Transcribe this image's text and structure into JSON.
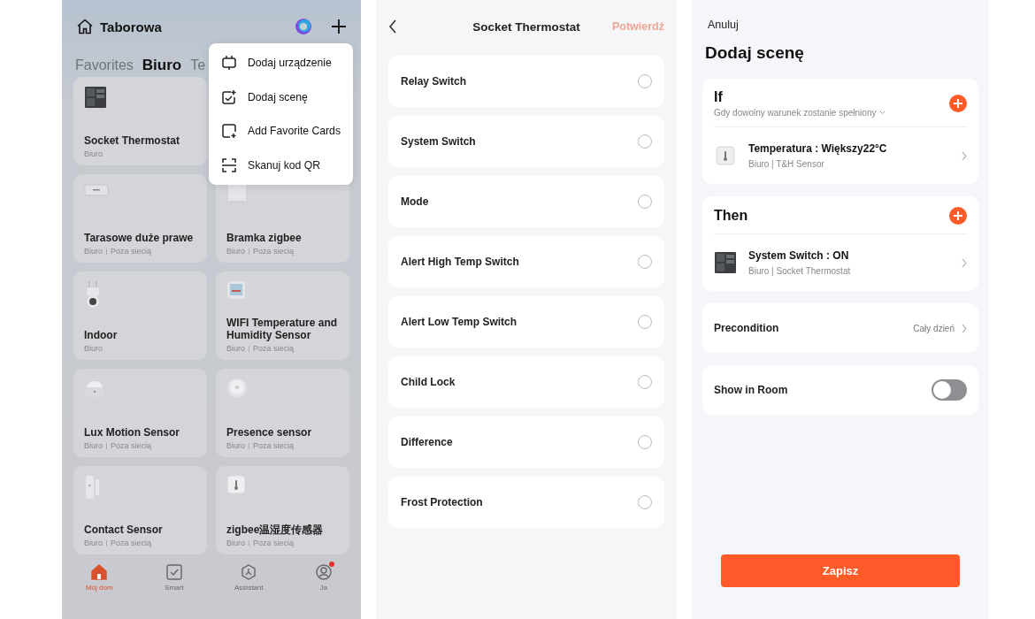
{
  "home": {
    "title": "Taborowa",
    "tabs": [
      {
        "label": "Favorites",
        "selected": false
      },
      {
        "label": "Biuro",
        "selected": true
      },
      {
        "label": "Te",
        "selected": false
      }
    ],
    "menu": [
      {
        "kind": "device",
        "label": "Dodaj urządzenie"
      },
      {
        "kind": "scene",
        "label": "Dodaj scenę"
      },
      {
        "kind": "card",
        "label": "Add Favorite Cards"
      },
      {
        "kind": "scan",
        "label": "Skanuj kod QR"
      }
    ],
    "device_rows": [
      [
        {
          "kind": "socket",
          "name": "Socket Thermostat",
          "room": "Biuro"
        }
      ],
      [
        {
          "kind": "panel",
          "name": "Tarasowe duże prawe",
          "room": "Biuro",
          "status": "Poza siecią"
        },
        {
          "kind": "hub",
          "name": "Bramka zigbee",
          "room": "Biuro",
          "status": "Poza siecią"
        }
      ],
      [
        {
          "kind": "camera",
          "name": "Indoor",
          "room": "Biuro"
        },
        {
          "kind": "display",
          "name": "WIFI Temperature and Humidity Sensor",
          "room": "Biuro",
          "status": "Poza siecią"
        }
      ],
      [
        {
          "kind": "motion",
          "name": "Lux Motion Sensor",
          "room": "Biuro",
          "status": "Poza siecią"
        },
        {
          "kind": "presence",
          "name": "Presence sensor",
          "room": "Biuro",
          "status": "Poza siecią"
        }
      ],
      [
        {
          "kind": "contact",
          "name": "Contact Sensor",
          "room": "Biuro",
          "status": "Poza siecią"
        },
        {
          "kind": "thermo",
          "name": "zigbee温湿度传感器",
          "room": "Biuro",
          "status": "Poza siecią"
        }
      ]
    ],
    "nav": [
      {
        "kind": "home",
        "label": "Mój dom",
        "selected": true,
        "badge": false
      },
      {
        "kind": "smart",
        "label": "Smart",
        "selected": false,
        "badge": false
      },
      {
        "kind": "assistant",
        "label": "Assistant",
        "selected": false,
        "badge": false
      },
      {
        "kind": "me",
        "label": "Ja",
        "selected": false,
        "badge": true
      }
    ]
  },
  "picker": {
    "title": "Socket Thermostat",
    "confirm": "Potwierdź",
    "confirm_disabled": true,
    "options": [
      {
        "label": "Relay Switch",
        "selected": false
      },
      {
        "label": "System Switch",
        "selected": false
      },
      {
        "label": "Mode",
        "selected": false
      },
      {
        "label": "Alert High Temp Switch",
        "selected": false
      },
      {
        "label": "Alert Low Temp Switch",
        "selected": false
      },
      {
        "label": "Child Lock",
        "selected": false
      },
      {
        "label": "Difference",
        "selected": false
      },
      {
        "label": "Frost Protection",
        "selected": false
      }
    ]
  },
  "scene": {
    "cancel": "Anuluj",
    "title": "Dodaj scenę",
    "if": {
      "heading": "If",
      "subtitle": "Gdy dowolny warunek zostanie spełniony",
      "items": [
        {
          "kind": "thermo",
          "title": "Temperatura : Większy22°C",
          "subtitle": "Biuro | T&H Sensor"
        }
      ]
    },
    "then": {
      "heading": "Then",
      "items": [
        {
          "kind": "socket",
          "title": "System Switch : ON",
          "subtitle": "Biuro | Socket Thermostat"
        }
      ]
    },
    "precondition": {
      "label": "Precondition",
      "value": "Cały dzień"
    },
    "show_in_room": {
      "label": "Show in Room",
      "on": false
    },
    "save": "Zapisz"
  }
}
